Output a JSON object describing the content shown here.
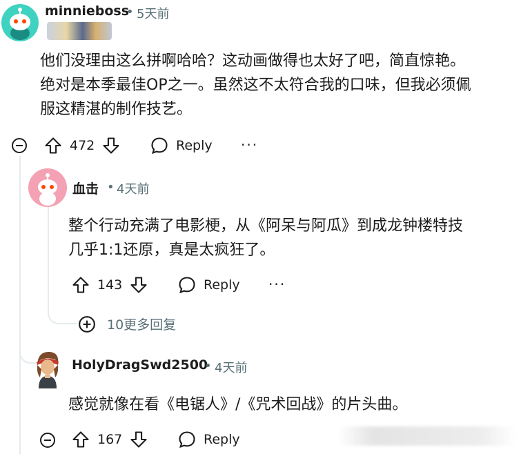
{
  "comments": [
    {
      "username": "minnieboss",
      "time": "5天前",
      "body_lines": [
        "他们没理由这么拼啊哈哈？这动画做得也太好了吧，简直惊艳。",
        "绝对是本季最佳OP之一。虽然这不太符合我的口味，但我必须佩",
        "服这精湛的制作技艺。"
      ],
      "votes": "472",
      "reply_label": "Reply",
      "more_label": "···"
    },
    {
      "username": "血击",
      "time": "4天前",
      "body_lines": [
        "整个行动充满了电影梗，从《阿呆与阿瓜》到成龙钟楼特技",
        "几乎1:1还原，真是太疯狂了。"
      ],
      "votes": "143",
      "reply_label": "Reply",
      "more_label": "···"
    },
    {
      "username": "HolyDragSwd2500",
      "time": "4天前",
      "body_lines": [
        "感觉就像在看《电锯人》/《咒术回战》的片头曲。"
      ],
      "votes": "167",
      "reply_label": "Reply"
    }
  ],
  "more_replies": "10更多回复",
  "colors": {
    "meta": "#576f76",
    "avatar_teal": "#3fd2c0",
    "avatar_pink": "#f4a2b3",
    "thread_line": "#e5ebee"
  },
  "icons": [
    "snoo-avatar-icon",
    "upvote-icon",
    "downvote-icon",
    "reply-bubble-icon",
    "collapse-minus-icon",
    "expand-plus-icon"
  ]
}
